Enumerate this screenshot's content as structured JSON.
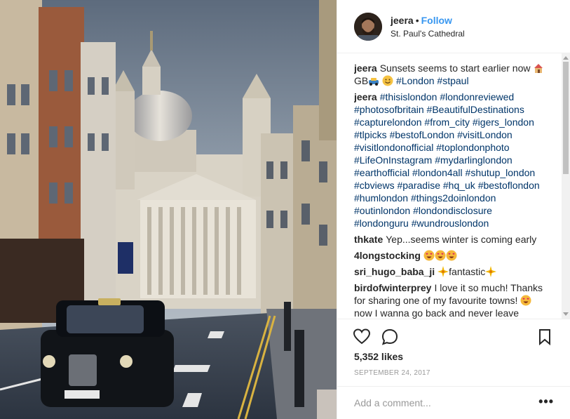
{
  "header": {
    "username": "jeera",
    "separator": "•",
    "follow_label": "Follow",
    "location": "St. Paul's Cathedral"
  },
  "comments": [
    {
      "user": "jeera",
      "parts": [
        {
          "t": "text",
          "v": "Sunsets seems to start earlier now "
        },
        {
          "t": "icon",
          "v": "house-emoji"
        },
        {
          "t": "text",
          "v": " GB"
        },
        {
          "t": "icon",
          "v": "car-emoji"
        },
        {
          "t": "text",
          "v": " "
        },
        {
          "t": "icon",
          "v": "smile-emoji"
        },
        {
          "t": "text",
          "v": " "
        },
        {
          "t": "tag",
          "v": "#London"
        },
        {
          "t": "text",
          "v": " "
        },
        {
          "t": "tag",
          "v": "#stpaul"
        }
      ]
    },
    {
      "user": "jeera",
      "parts": [
        {
          "t": "tag",
          "v": "#thisislondon"
        },
        {
          "t": "text",
          "v": " "
        },
        {
          "t": "tag",
          "v": "#londonreviewed"
        },
        {
          "t": "text",
          "v": " "
        },
        {
          "t": "tag",
          "v": "#photosofbritain"
        },
        {
          "t": "text",
          "v": " "
        },
        {
          "t": "tag",
          "v": "#BeautifulDestinations"
        },
        {
          "t": "text",
          "v": " "
        },
        {
          "t": "tag",
          "v": "#capturelondon"
        },
        {
          "t": "text",
          "v": " "
        },
        {
          "t": "tag",
          "v": "#from_city"
        },
        {
          "t": "text",
          "v": " "
        },
        {
          "t": "tag",
          "v": "#igers_london"
        },
        {
          "t": "text",
          "v": " "
        },
        {
          "t": "tag",
          "v": "#tlpicks"
        },
        {
          "t": "text",
          "v": " "
        },
        {
          "t": "tag",
          "v": "#bestofLondon"
        },
        {
          "t": "text",
          "v": " "
        },
        {
          "t": "tag",
          "v": "#visitLondon"
        },
        {
          "t": "text",
          "v": " "
        },
        {
          "t": "tag",
          "v": "#visitlondonofficial"
        },
        {
          "t": "text",
          "v": " "
        },
        {
          "t": "tag",
          "v": "#toplondonphoto"
        },
        {
          "t": "text",
          "v": " "
        },
        {
          "t": "tag",
          "v": "#LifeOnInstagram"
        },
        {
          "t": "text",
          "v": " "
        },
        {
          "t": "tag",
          "v": "#mydarlinglondon"
        },
        {
          "t": "text",
          "v": " "
        },
        {
          "t": "tag",
          "v": "#earthofficial"
        },
        {
          "t": "text",
          "v": " "
        },
        {
          "t": "tag",
          "v": "#london4all"
        },
        {
          "t": "text",
          "v": " "
        },
        {
          "t": "tag",
          "v": "#shutup_london"
        },
        {
          "t": "text",
          "v": " "
        },
        {
          "t": "tag",
          "v": "#cbviews"
        },
        {
          "t": "text",
          "v": " "
        },
        {
          "t": "tag",
          "v": "#paradise"
        },
        {
          "t": "text",
          "v": " "
        },
        {
          "t": "tag",
          "v": "#hq_uk"
        },
        {
          "t": "text",
          "v": " "
        },
        {
          "t": "tag",
          "v": "#bestoflondon"
        },
        {
          "t": "text",
          "v": " "
        },
        {
          "t": "tag",
          "v": "#humlondon"
        },
        {
          "t": "text",
          "v": " "
        },
        {
          "t": "tag",
          "v": "#things2doinlondon"
        },
        {
          "t": "text",
          "v": " "
        },
        {
          "t": "tag",
          "v": "#outinlondon"
        },
        {
          "t": "text",
          "v": " "
        },
        {
          "t": "tag",
          "v": "#londondisclosure"
        },
        {
          "t": "text",
          "v": " "
        },
        {
          "t": "tag",
          "v": "#londonguru"
        },
        {
          "t": "text",
          "v": " "
        },
        {
          "t": "tag",
          "v": "#wundrouslondon"
        }
      ]
    },
    {
      "user": "thkate",
      "parts": [
        {
          "t": "text",
          "v": "Yep...seems winter is coming early"
        }
      ]
    },
    {
      "user": "4longstocking",
      "parts": [
        {
          "t": "icon",
          "v": "heart-eyes-emoji"
        },
        {
          "t": "icon",
          "v": "heart-eyes-emoji"
        },
        {
          "t": "icon",
          "v": "heart-eyes-emoji"
        }
      ]
    },
    {
      "user": "sri_hugo_baba_ji",
      "parts": [
        {
          "t": "icon",
          "v": "sparkle-emoji"
        },
        {
          "t": "text",
          "v": "fantastic"
        },
        {
          "t": "icon",
          "v": "sparkle-emoji"
        }
      ]
    },
    {
      "user": "birdofwinterprey",
      "parts": [
        {
          "t": "text",
          "v": "I love it so much! Thanks for sharing one of my favourite towns! "
        },
        {
          "t": "icon",
          "v": "heart-eyes-emoji"
        },
        {
          "t": "text",
          "v": " now I wanna go back and never leave"
        }
      ]
    }
  ],
  "actions": {
    "like_icon": "heart-icon",
    "comment_icon": "comment-icon",
    "save_icon": "bookmark-icon"
  },
  "likes": "5,352 likes",
  "date": "September 24, 2017",
  "add_comment": {
    "placeholder": "Add a comment...",
    "more_label": "•••"
  },
  "colors": {
    "link": "#003569",
    "follow": "#3897f0",
    "muted": "#999999",
    "border": "#efefef"
  }
}
